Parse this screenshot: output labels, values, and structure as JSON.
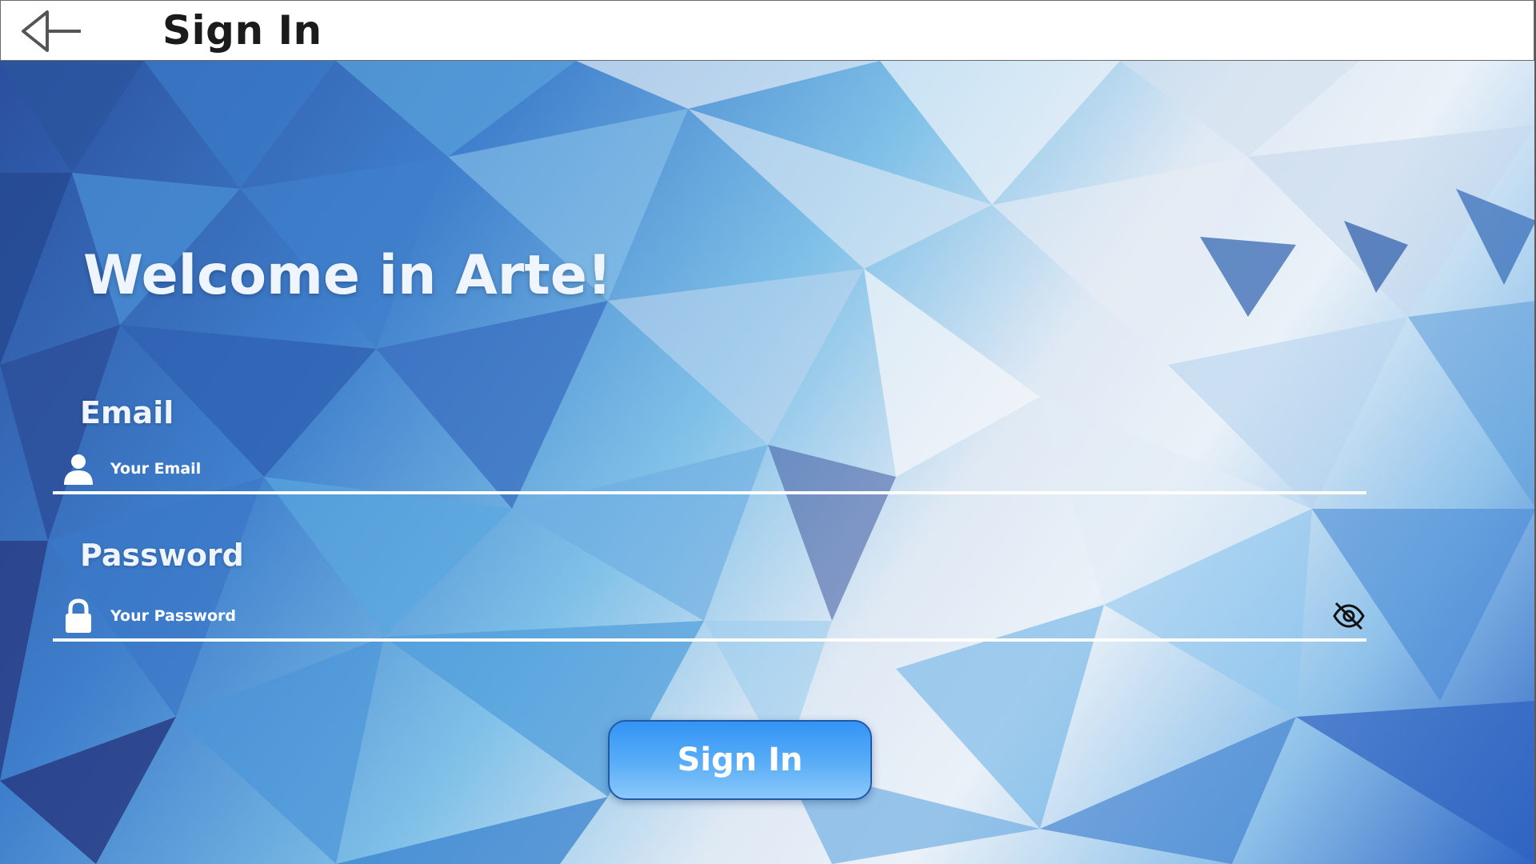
{
  "header": {
    "title": "Sign In",
    "back_icon": "back-arrow-icon"
  },
  "main": {
    "welcome": "Welcome in Arte!",
    "email": {
      "label": "Email",
      "placeholder": "Your Email",
      "value": "",
      "icon": "user-icon"
    },
    "password": {
      "label": "Password",
      "placeholder": "Your Password",
      "value": "",
      "icon": "lock-icon",
      "toggle_icon": "eye-off-icon"
    },
    "signin_label": "Sign In"
  },
  "colors": {
    "accent": "#3394f5",
    "background_dark": "#2a4f9e",
    "background_light": "#eaf1f8",
    "text_light": "#eef5ff"
  }
}
